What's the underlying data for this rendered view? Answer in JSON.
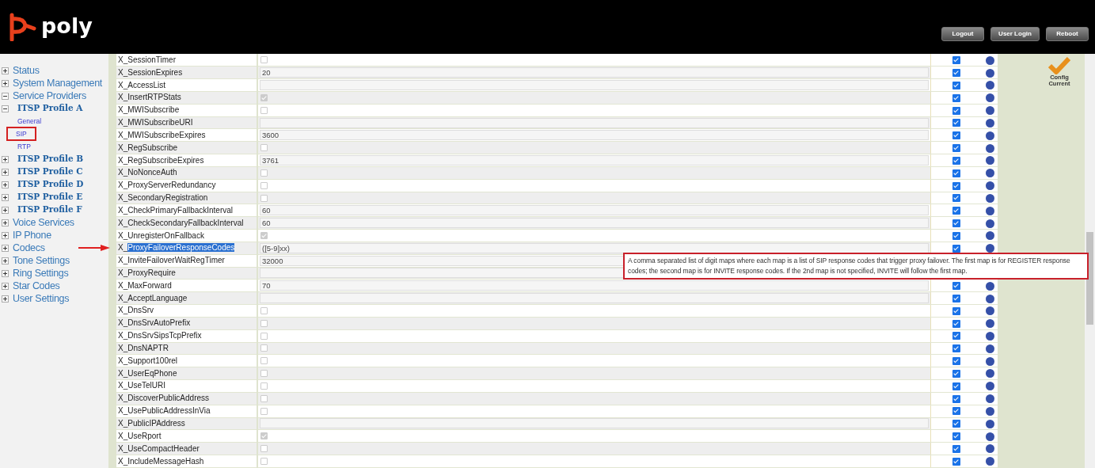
{
  "header": {
    "logo_text": "poly",
    "buttons": [
      "Logout",
      "User Login",
      "Reboot"
    ]
  },
  "sidebar": {
    "items": [
      {
        "label": "Status",
        "expanded": false
      },
      {
        "label": "System Management",
        "expanded": false
      },
      {
        "label": "Service Providers",
        "expanded": true,
        "children": [
          {
            "label": "ITSP Profile A",
            "expanded": true,
            "children": [
              {
                "label": "General",
                "selected": false
              },
              {
                "label": "SIP",
                "selected": true
              },
              {
                "label": "RTP",
                "selected": false
              }
            ]
          },
          {
            "label": "ITSP Profile B",
            "expanded": false
          },
          {
            "label": "ITSP Profile C",
            "expanded": false
          },
          {
            "label": "ITSP Profile D",
            "expanded": false
          },
          {
            "label": "ITSP Profile E",
            "expanded": false
          },
          {
            "label": "ITSP Profile F",
            "expanded": false
          }
        ]
      },
      {
        "label": "Voice Services",
        "expanded": false
      },
      {
        "label": "IP Phone",
        "expanded": false
      },
      {
        "label": "Codecs",
        "expanded": false
      },
      {
        "label": "Tone Settings",
        "expanded": false
      },
      {
        "label": "Ring Settings",
        "expanded": false
      },
      {
        "label": "Star Codes",
        "expanded": false
      },
      {
        "label": "User Settings",
        "expanded": false
      }
    ]
  },
  "settings": {
    "rows": [
      {
        "name": "X_SessionTimer",
        "kind": "checkbox",
        "checked": false,
        "include": true
      },
      {
        "name": "X_SessionExpires",
        "kind": "text",
        "value": "20",
        "include": true
      },
      {
        "name": "X_AccessList",
        "kind": "text",
        "include": true
      },
      {
        "name": "X_InsertRTPStats",
        "kind": "checkbox",
        "checked": true,
        "include": true
      },
      {
        "name": "X_MWISubscribe",
        "kind": "checkbox",
        "checked": false,
        "include": true
      },
      {
        "name": "X_MWISubscribeURI",
        "kind": "text",
        "include": true
      },
      {
        "name": "X_MWISubscribeExpires",
        "kind": "text",
        "value": "3600",
        "include": true
      },
      {
        "name": "X_RegSubscribe",
        "kind": "checkbox",
        "checked": false,
        "include": true
      },
      {
        "name": "X_RegSubscribeExpires",
        "kind": "text",
        "value": "3761",
        "include": true
      },
      {
        "name": "X_NoNonceAuth",
        "kind": "checkbox",
        "checked": false,
        "include": true
      },
      {
        "name": "X_ProxyServerRedundancy",
        "kind": "checkbox",
        "checked": false,
        "include": true
      },
      {
        "name": "X_SecondaryRegistration",
        "kind": "checkbox",
        "checked": false,
        "include": true
      },
      {
        "name": "X_CheckPrimaryFallbackInterval",
        "kind": "text",
        "value": "60",
        "include": true
      },
      {
        "name": "X_CheckSecondaryFallbackInterval",
        "kind": "text",
        "value": "60",
        "include": true
      },
      {
        "name": "X_UnregisterOnFallback",
        "kind": "checkbox",
        "checked": true,
        "include": true
      },
      {
        "name": "X_",
        "selected_text": "ProxyFailoverResponseCodes",
        "kind": "text",
        "value": "([5-9]xx)",
        "include": true,
        "tooltip": "A comma separated list of digit maps where each map is a list of SIP response codes that trigger proxy failover. The first map is for REGISTER response codes; the second map is for INVITE response codes. If the 2nd map is not specified, INVITE will follow the first map."
      },
      {
        "name": "X_InviteFailoverWaitRegTimer",
        "kind": "text",
        "value": "32000"
      },
      {
        "name": "X_ProxyRequire",
        "kind": "text"
      },
      {
        "name": "X_MaxForward",
        "kind": "text",
        "value": "70",
        "include": true
      },
      {
        "name": "X_AcceptLanguage",
        "kind": "text",
        "include": true
      },
      {
        "name": "X_DnsSrv",
        "kind": "checkbox",
        "checked": false,
        "include": true
      },
      {
        "name": "X_DnsSrvAutoPrefix",
        "kind": "checkbox",
        "checked": false,
        "include": true
      },
      {
        "name": "X_DnsSrvSipsTcpPrefix",
        "kind": "checkbox",
        "checked": false,
        "include": true
      },
      {
        "name": "X_DnsNAPTR",
        "kind": "checkbox",
        "checked": false,
        "include": true
      },
      {
        "name": "X_Support100rel",
        "kind": "checkbox",
        "checked": false,
        "include": true
      },
      {
        "name": "X_UserEqPhone",
        "kind": "checkbox",
        "checked": false,
        "include": true
      },
      {
        "name": "X_UseTelURI",
        "kind": "checkbox",
        "checked": false,
        "include": true
      },
      {
        "name": "X_DiscoverPublicAddress",
        "kind": "checkbox",
        "checked": false,
        "include": true
      },
      {
        "name": "X_UsePublicAddressInVia",
        "kind": "checkbox",
        "checked": false,
        "include": true
      },
      {
        "name": "X_PublicIPAddress",
        "kind": "text",
        "include": true
      },
      {
        "name": "X_UseRport",
        "kind": "checkbox",
        "checked": true,
        "include": true
      },
      {
        "name": "X_UseCompactHeader",
        "kind": "checkbox",
        "checked": false,
        "include": true
      },
      {
        "name": "X_IncludeMessageHash",
        "kind": "checkbox",
        "checked": false,
        "include": true
      }
    ]
  },
  "status": {
    "label": "Config Current"
  }
}
